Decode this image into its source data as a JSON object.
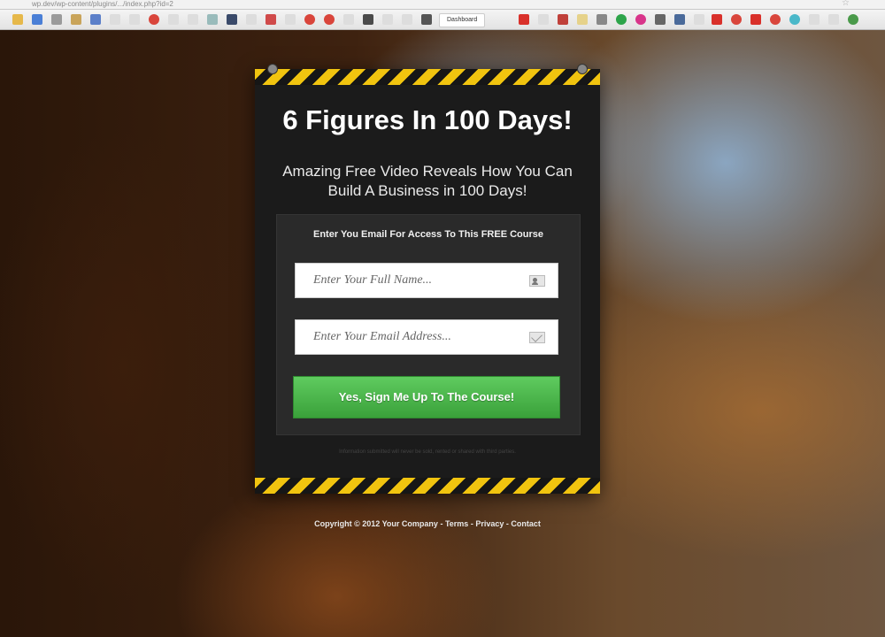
{
  "browser": {
    "url": "wp.dev/wp-content/plugins/.../index.php?id=2",
    "bookmark_tab_label": "Dashboard"
  },
  "popup": {
    "headline": "6 Figures In 100 Days!",
    "subheadline": "Amazing Free Video Reveals How You Can Build A Business in 100 Days!",
    "form": {
      "label": "Enter You Email For Access To This FREE Course",
      "name_placeholder": "Enter Your Full Name...",
      "email_placeholder": "Enter Your Email Address...",
      "submit_label": "Yes, Sign Me Up To The Course!"
    },
    "privacy_text": "Information submitted will never be sold, rented or shared with third parties."
  },
  "footer": {
    "copyright": "Copyright © 2012 Your Company",
    "terms": "Terms",
    "privacy": "Privacy",
    "contact": "Contact"
  },
  "colors": {
    "accent_green": "#4cb84c",
    "stripe_yellow": "#f1c40f",
    "panel_dark": "#1b1b1b"
  }
}
